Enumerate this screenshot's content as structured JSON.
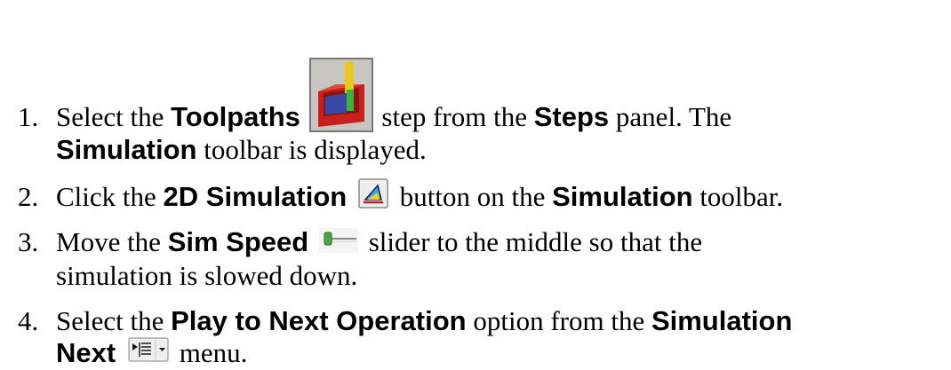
{
  "steps": [
    {
      "number": "1.",
      "l1": {
        "a": "Select the ",
        "b1": "Toolpaths",
        "c": " step from the ",
        "b2": "Steps",
        "d": " panel. The"
      },
      "l2": {
        "b1": "Simulation",
        "a": " toolbar is displayed."
      },
      "icon": "toolpaths-step-icon"
    },
    {
      "number": "2.",
      "l1": {
        "a": "Click the ",
        "b1": "2D Simulation",
        "c": " button on the ",
        "b2": "Simulation",
        "d": " toolbar."
      },
      "icon": "2d-simulation-icon"
    },
    {
      "number": "3.",
      "l1": {
        "a": "Move the ",
        "b1": "Sim Speed",
        "c": " slider to the middle so that the"
      },
      "l2": {
        "a": "simulation is slowed down."
      },
      "icon": "sim-speed-slider-icon"
    },
    {
      "number": "4.",
      "l1": {
        "a": "Select the ",
        "b1": "Play to Next Operation",
        "c": " option from the ",
        "b2": "Simulation"
      },
      "l2": {
        "b1": "Next",
        "c": " menu."
      },
      "icon": "simulation-next-icon"
    }
  ],
  "colors": {
    "text": "#000000",
    "background": "#ffffff"
  }
}
